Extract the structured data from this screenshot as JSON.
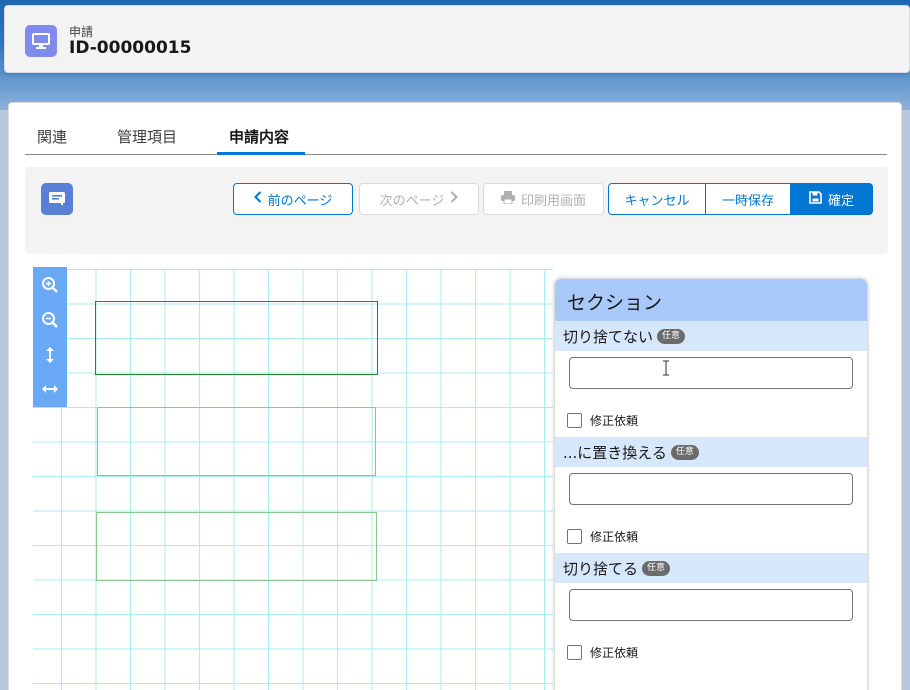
{
  "header": {
    "object_label": "申請",
    "record_name": "ID-00000015"
  },
  "tabs": [
    {
      "label": "関連",
      "active": false
    },
    {
      "label": "管理項目",
      "active": false
    },
    {
      "label": "申請内容",
      "active": true
    }
  ],
  "toolbar": {
    "prev_label": "前のページ",
    "next_label": "次のページ",
    "print_label": "印刷用画面",
    "cancel_label": "キャンセル",
    "save_draft_label": "一時保存",
    "confirm_label": "確定"
  },
  "zoom_tools": [
    "zoom-in-icon",
    "zoom-out-icon",
    "fit-height-icon",
    "fit-width-icon"
  ],
  "section": {
    "title": "セクション",
    "fields": [
      {
        "label": "切り捨てない",
        "badge": "任意",
        "value": "",
        "checkbox_label": "修正依頼"
      },
      {
        "label": "...に置き換える",
        "badge": "任意",
        "value": "",
        "checkbox_label": "修正依頼"
      },
      {
        "label": "切り捨てる",
        "badge": "任意",
        "value": "",
        "checkbox_label": "修正依頼"
      }
    ]
  },
  "colors": {
    "brand": "#0176d3",
    "grid": "#a9ecf2",
    "selected_box": "#1b8a2f",
    "section_header": "#a8c9f9"
  }
}
